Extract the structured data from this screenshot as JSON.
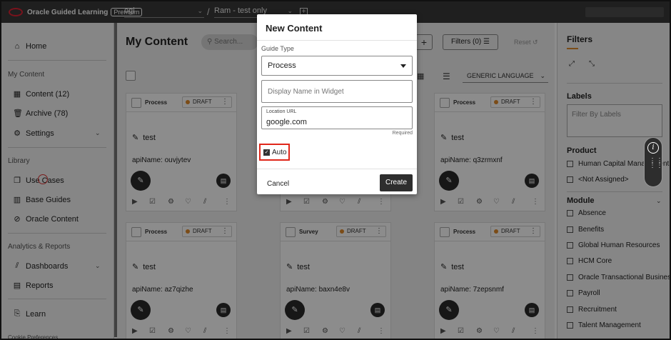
{
  "topbar": {
    "brand": "Oracle Guided Learning",
    "premium": "Premium",
    "app_select": "ogl",
    "slash": "/",
    "env_select": "Ram - test only",
    "add": "+"
  },
  "sidebar": {
    "items": [
      {
        "label": "Home",
        "icon": "home-icon",
        "glyph": "⌂"
      },
      {
        "label": "Content (12)",
        "icon": "grid-icon",
        "glyph": "▦"
      },
      {
        "label": "Archive (78)",
        "icon": "trash-icon",
        "glyph": "🗑"
      },
      {
        "label": "Settings",
        "icon": "gear-icon",
        "glyph": "⚙"
      },
      {
        "label": "Use Cases",
        "icon": "stack-icon",
        "glyph": "❐"
      },
      {
        "label": "Base Guides",
        "icon": "book-icon",
        "glyph": "▥"
      },
      {
        "label": "Oracle Content",
        "icon": "badge-icon",
        "glyph": "⊘"
      },
      {
        "label": "Dashboards",
        "icon": "chart-icon",
        "glyph": "⫽"
      },
      {
        "label": "Reports",
        "icon": "report-icon",
        "glyph": "▤"
      },
      {
        "label": "Learn",
        "icon": "learn-icon",
        "glyph": "⎘"
      }
    ],
    "sections": [
      "My Content",
      "Library",
      "Analytics & Reports"
    ],
    "footer": "Cookie Preferences"
  },
  "main": {
    "title": "My Content",
    "search_placeholder": "Search...",
    "plus": "+",
    "filters_label": "Filters (0)",
    "reset_label": "Reset",
    "language": "GENERIC LANGUAGE"
  },
  "cards": [
    {
      "type": "Process",
      "status": "DRAFT",
      "name": "test",
      "api": "apiName: ouvjytev"
    },
    {
      "type": "Process",
      "status": "DRAFT",
      "name": "test",
      "api": "apiName: q3zrmxnf"
    },
    {
      "type": "Process",
      "status": "DRAFT",
      "name": "test",
      "api": "apiName: az7qizhe"
    },
    {
      "type": "Survey",
      "status": "DRAFT",
      "name": "test",
      "api": "apiName: baxn4e8v"
    },
    {
      "type": "Process",
      "status": "DRAFT",
      "name": "test",
      "api": "apiName: 7zepsnmf"
    }
  ],
  "filters_panel": {
    "title": "Filters",
    "labels_heading": "Labels",
    "labels_placeholder": "Filter By Labels",
    "product_heading": "Product",
    "product_options": [
      "Human Capital Management",
      "<Not Assigned>"
    ],
    "module_heading": "Module",
    "module_options": [
      "Absence",
      "Benefits",
      "Global Human Resources",
      "HCM Core",
      "Oracle Transactional Business Intelligence",
      "Payroll",
      "Recruitment",
      "Talent Management"
    ]
  },
  "modal": {
    "title": "New Content",
    "guide_type_label": "Guide Type",
    "guide_type_value": "Process",
    "display_name_placeholder": "Display Name in Widget",
    "location_label": "Location URL",
    "location_value": "google.com",
    "required": "Required",
    "auto_label": "Auto",
    "cancel": "Cancel",
    "create": "Create"
  }
}
